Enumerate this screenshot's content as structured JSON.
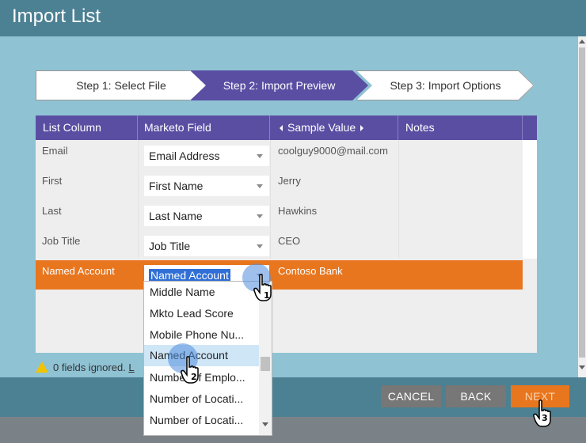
{
  "window": {
    "title": "Import List"
  },
  "steps": [
    {
      "label": "Step 1: Select File"
    },
    {
      "label": "Step 2: Import Preview"
    },
    {
      "label": "Step 3: Import Options"
    }
  ],
  "table": {
    "columns": [
      "List Column",
      "Marketo Field",
      "Sample Value",
      "Notes"
    ],
    "rows": [
      {
        "list_column": "Email",
        "marketo_field": "Email Address",
        "sample_value": "coolguy9000@mail.com"
      },
      {
        "list_column": "First",
        "marketo_field": "First Name",
        "sample_value": "Jerry"
      },
      {
        "list_column": "Last",
        "marketo_field": "Last Name",
        "sample_value": "Hawkins"
      },
      {
        "list_column": "Job Title",
        "marketo_field": "Job Title",
        "sample_value": "CEO"
      },
      {
        "list_column": "Named Account",
        "marketo_field": "Named Account",
        "sample_value": "Contoso Bank"
      }
    ]
  },
  "dropdown": {
    "options": [
      "Middle Name",
      "Mkto Lead Score",
      "Mobile Phone Nu...",
      "Named Account",
      "Number of Emplo...",
      "Number of Locati...",
      "Number of Locati..."
    ],
    "highlighted": "Named Account"
  },
  "status": {
    "ignored_text": "0 fields ignored.",
    "link_text": "L"
  },
  "buttons": {
    "cancel": "CANCEL",
    "back": "BACK",
    "next": "NEXT"
  },
  "markers": [
    "1",
    "2",
    "3"
  ],
  "colors": {
    "accent_purple": "#5a4ea3",
    "accent_orange": "#e8761e",
    "header_teal": "#4b8193"
  }
}
